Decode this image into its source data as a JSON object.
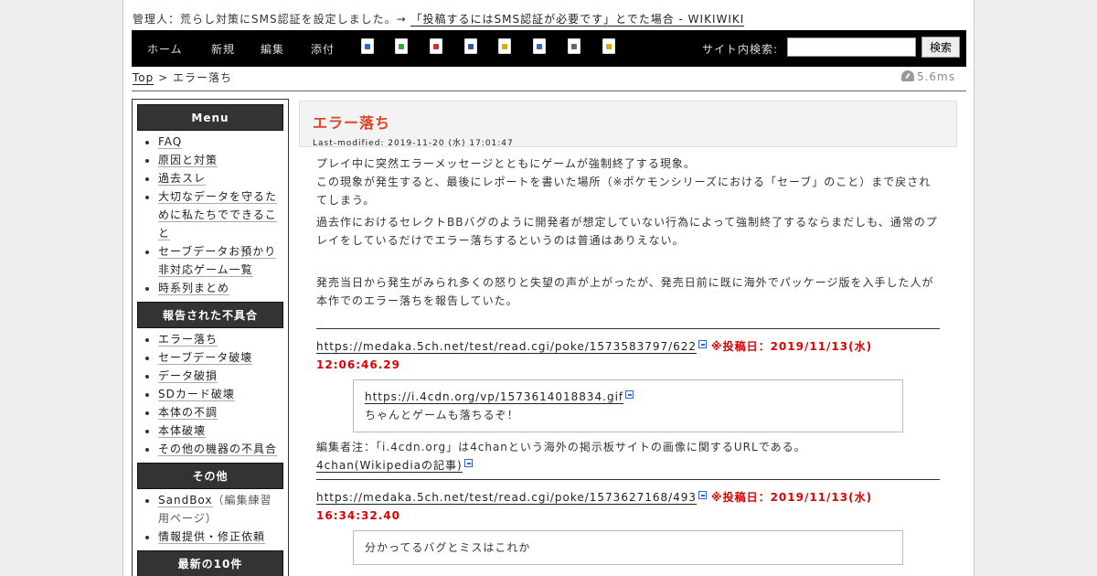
{
  "notice": {
    "prefix": "管理人：荒らし対策にSMS認証を設定しました。→",
    "link": "「投稿するにはSMS認証が必要です」とでた場合 - WIKIWIKI"
  },
  "nav": {
    "links": [
      "ホーム",
      "新規",
      "編集",
      "添付"
    ],
    "icons": [
      {
        "name": "page-list-icon",
        "color": "#3366cc"
      },
      {
        "name": "recent-icon",
        "color": "#33aa33"
      },
      {
        "name": "delete-icon",
        "color": "#cc3333"
      },
      {
        "name": "save-icon",
        "color": "#3355aa"
      },
      {
        "name": "lock-icon",
        "color": "#ddaa00"
      },
      {
        "name": "copy-icon",
        "color": "#3366cc"
      },
      {
        "name": "document-icon",
        "color": "#666666"
      },
      {
        "name": "help-icon",
        "color": "#ddaa00"
      }
    ],
    "search_label": "サイト内検索:",
    "search_value": "",
    "search_button": "検索"
  },
  "breadcrumb": {
    "top": "Top",
    "sep": " > ",
    "current": "エラー落ち"
  },
  "timing": "5.6ms",
  "menubar": {
    "sections": [
      {
        "title": "Menu",
        "items": [
          {
            "label": "FAQ"
          },
          {
            "label": "原因と対策"
          },
          {
            "label": "過去スレ"
          },
          {
            "label": "大切なデータを守るために私たちでできること"
          },
          {
            "label": "セーブデータお預かり非対応ゲーム一覧"
          },
          {
            "label": "時系列まとめ"
          }
        ]
      },
      {
        "title": "報告された不具合",
        "items": [
          {
            "label": "エラー落ち"
          },
          {
            "label": "セーブデータ破壊"
          },
          {
            "label": "データ破損"
          },
          {
            "label": "SDカード破壊"
          },
          {
            "label": "本体の不調"
          },
          {
            "label": "本体破壊"
          },
          {
            "label": "その他の機器の不具合"
          }
        ]
      },
      {
        "title": "その他",
        "items": [
          {
            "label": "SandBox",
            "note": "（編集練習用ページ）"
          },
          {
            "label": "情報提供・修正依頼"
          }
        ]
      },
      {
        "title": "最新の10件",
        "items": []
      }
    ]
  },
  "content": {
    "title": "エラー落ち",
    "last_modified": "Last-modified: 2019-11-20 (水) 17:01:47",
    "p1a": "プレイ中に突然エラーメッセージとともにゲームが強制終了する現象。",
    "p1b": "この現象が発生すると、最後にレポートを書いた場所（※ポケモンシリーズにおける「セーブ」のこと）まで戻されてしまう。",
    "p2": "過去作におけるセレクトBBバグのように開発者が想定していない行為によって強制終了するならまだしも、通常のプレイをしているだけでエラー落ちするというのは普通はありえない。",
    "p3": "発売当日から発生がみられ多くの怒りと失望の声が上がったが、発売日前に既に海外でパッケージ版を入手した人が本作でのエラー落ちを報告していた。",
    "posts": [
      {
        "url": "https://medaka.5ch.net/test/read.cgi/poke/1573583797/622",
        "date": "※投稿日：2019/11/13(水) 12:06:46.29",
        "quote_link": "https://i.4cdn.org/vp/1573614018834.gif",
        "quote_text": "ちゃんとゲームも落ちるぞ！",
        "editor_note": "編集者注：「i.4cdn.org」は4chanという海外の掲示板サイトの画像に関するURLである。",
        "note_link": "4chan(Wikipediaの記事)"
      },
      {
        "url": "https://medaka.5ch.net/test/read.cgi/poke/1573627168/493",
        "date": "※投稿日：2019/11/13(水) 16:34:32.40",
        "quote_text": "分かってるバグとミスはこれか"
      }
    ]
  }
}
